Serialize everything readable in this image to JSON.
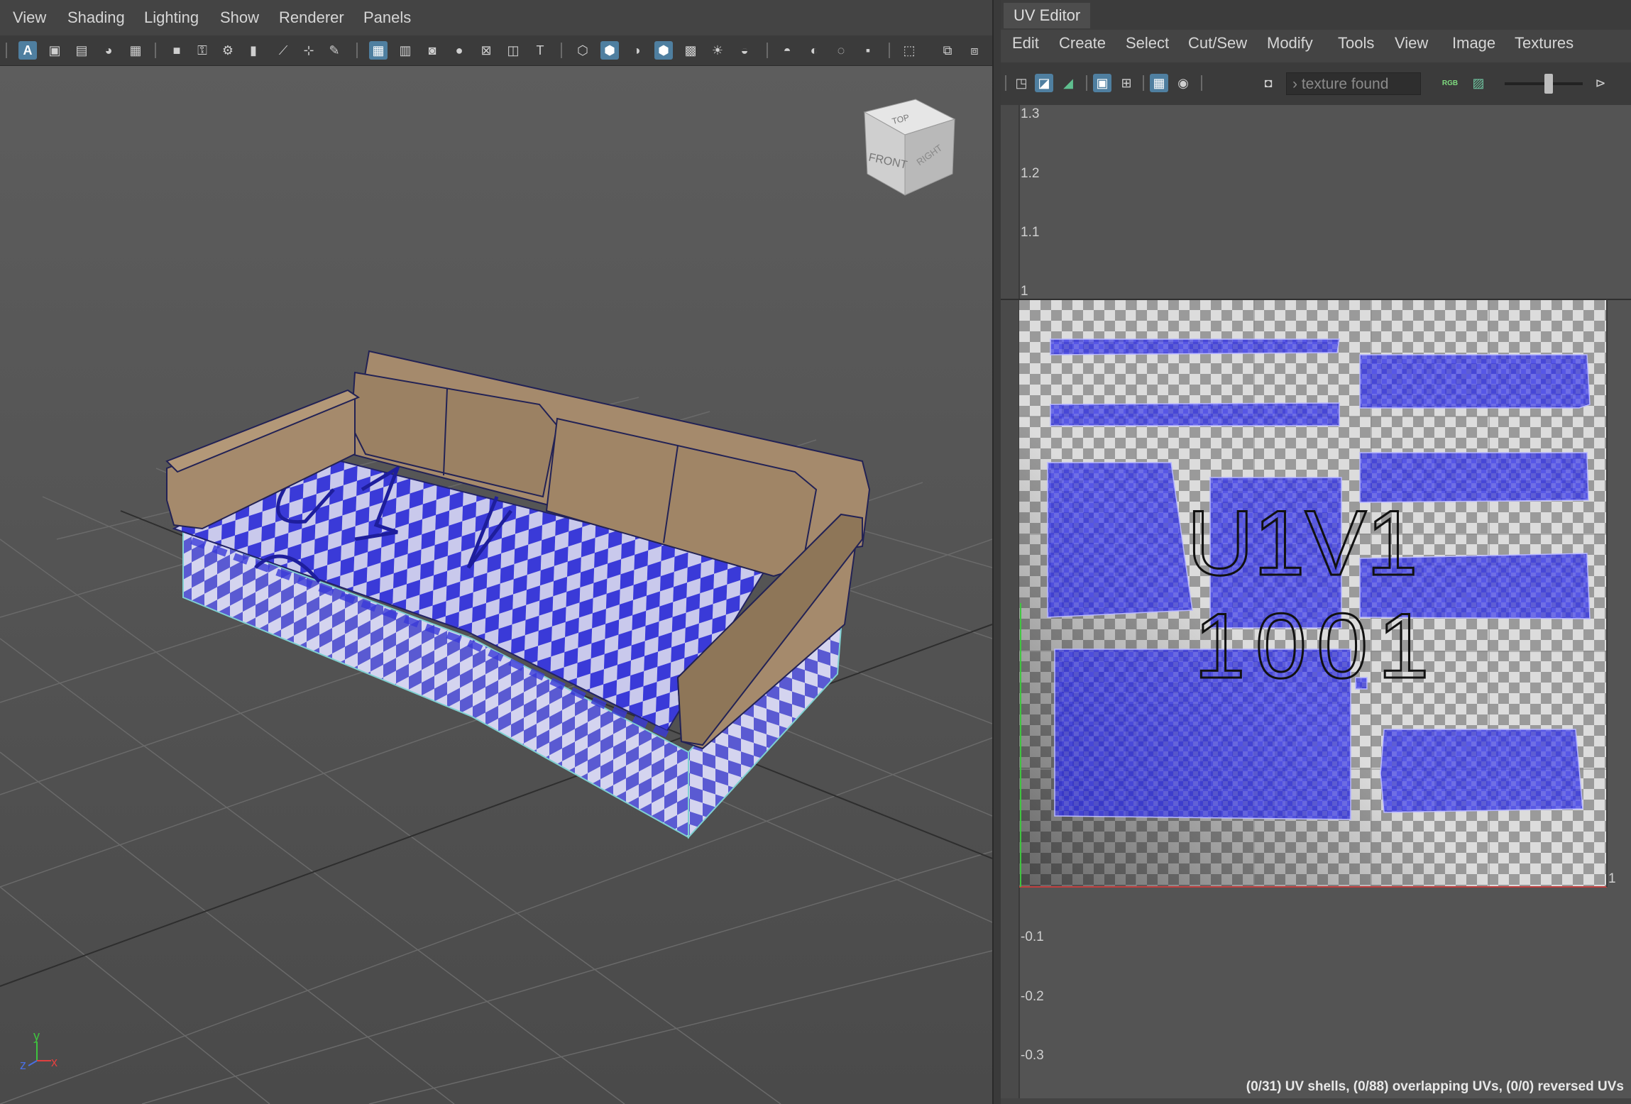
{
  "viewport": {
    "menus": [
      "View",
      "Shading",
      "Lighting",
      "Show",
      "Renderer",
      "Panels"
    ],
    "view_cube": {
      "top": "TOP",
      "front": "FRONT",
      "right": "RIGHT"
    },
    "axis": {
      "x": "x",
      "y": "y",
      "z": "z"
    },
    "uv_text": "U1V1"
  },
  "uv_editor": {
    "title": "UV Editor",
    "menus": [
      "Edit",
      "Create",
      "Select",
      "Cut/Sew",
      "Modify",
      "Tools",
      "View",
      "Image",
      "Textures"
    ],
    "texture_field": "› texture found",
    "rgb_label": "RGB",
    "ruler_labels_top": [
      "1.3",
      "1.2",
      "1.1",
      "1"
    ],
    "ruler_labels_bottom": [
      "-0.1",
      "-0.2",
      "-0.3"
    ],
    "right_tick": "1",
    "tile_label_1": "U1V1",
    "tile_label_2": "1001",
    "status": "(0/31) UV shells, (0/88) overlapping UVs, (0/0) reversed UVs"
  },
  "colors": {
    "checker_blue": "#3a3ad8",
    "checker_light": "#c9c9ec",
    "sofa_tan": "#a58a6c",
    "accent_blue": "#4f7fa0"
  }
}
